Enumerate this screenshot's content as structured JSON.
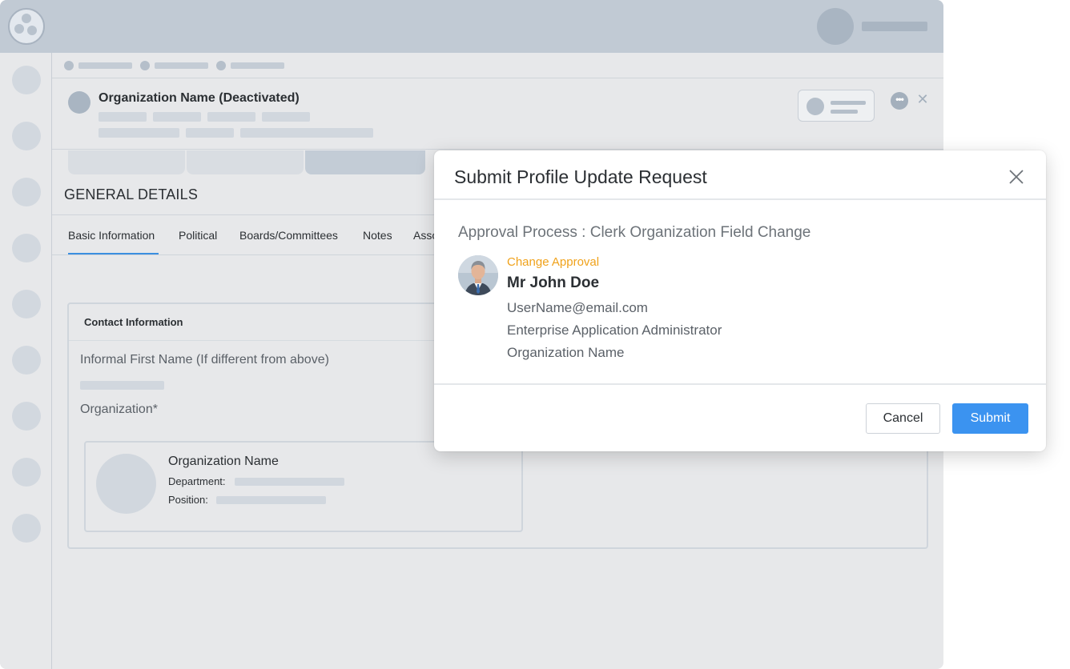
{
  "header": {
    "org_title": "Organization Name (Deactivated)"
  },
  "section": {
    "title": "GENERAL DETAILS"
  },
  "tabs": [
    {
      "label": "Basic Information",
      "active": true
    },
    {
      "label": "Political"
    },
    {
      "label": "Boards/Committees"
    },
    {
      "label": "Notes"
    },
    {
      "label": "Asso"
    }
  ],
  "contact": {
    "header": "Contact Information",
    "informal_first_name_label": "Informal First Name (If different from above)",
    "organization_label": "Organization*",
    "org_card": {
      "name": "Organization Name",
      "department_label": "Department:",
      "position_label": "Position:"
    }
  },
  "modal": {
    "title": "Submit Profile Update Request",
    "approval_process": "Approval Process : Clerk Organization Field Change",
    "approver": {
      "role_tag": "Change Approval",
      "name": "Mr John Doe",
      "email": "UserName@email.com",
      "title": "Enterprise Application Administrator",
      "organization": "Organization Name"
    },
    "cancel_label": "Cancel",
    "submit_label": "Submit"
  },
  "colors": {
    "accent": "#3b93f0",
    "tab_underline": "#3b8fe0",
    "approval_tag": "#f0a21b"
  }
}
